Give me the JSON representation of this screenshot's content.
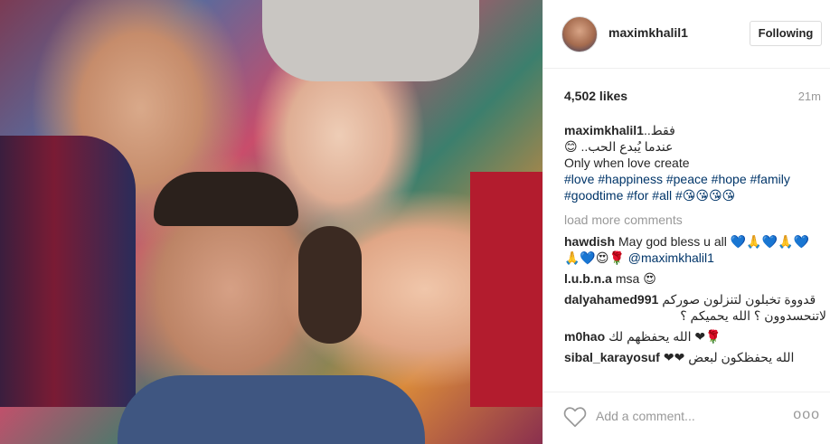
{
  "post": {
    "image_alt": "",
    "header": {
      "username": "maximkhalil1",
      "follow_label": "Following"
    },
    "likes": "4,502 likes",
    "time_ago": "21m",
    "caption": {
      "username": "maximkhalil1",
      "line1": "فقط..",
      "line2": "😊 ..عندما يُبدع الحب",
      "line3": "Only when love create",
      "line4": "#love #happiness #peace #hope #family",
      "line5": "#goodtime #for #all #😘😘😘😘"
    },
    "load_more": "load more comments",
    "comments": [
      {
        "username": "hawdish",
        "text": "May god bless u all 💙🙏💙🙏💙",
        "text2": "🙏💙😍🌹",
        "mention": "@maximkhalil1"
      },
      {
        "username": "l.u.b.n.a",
        "text": "msa 😍"
      },
      {
        "username": "dalyahamed991",
        "text": "قدووة تخبلون لتنزلون صوركم",
        "text2": "لاتنحسدوون ؟ الله يحميكم ؟"
      },
      {
        "username": "m0hao",
        "text": "🌹❤ الله يحفظهم لك"
      },
      {
        "username": "sibal_karayosuf",
        "text": "الله يحفظكون لبعض ❤❤"
      }
    ],
    "add_comment_placeholder": "Add a comment...",
    "more_label": "ooo"
  }
}
